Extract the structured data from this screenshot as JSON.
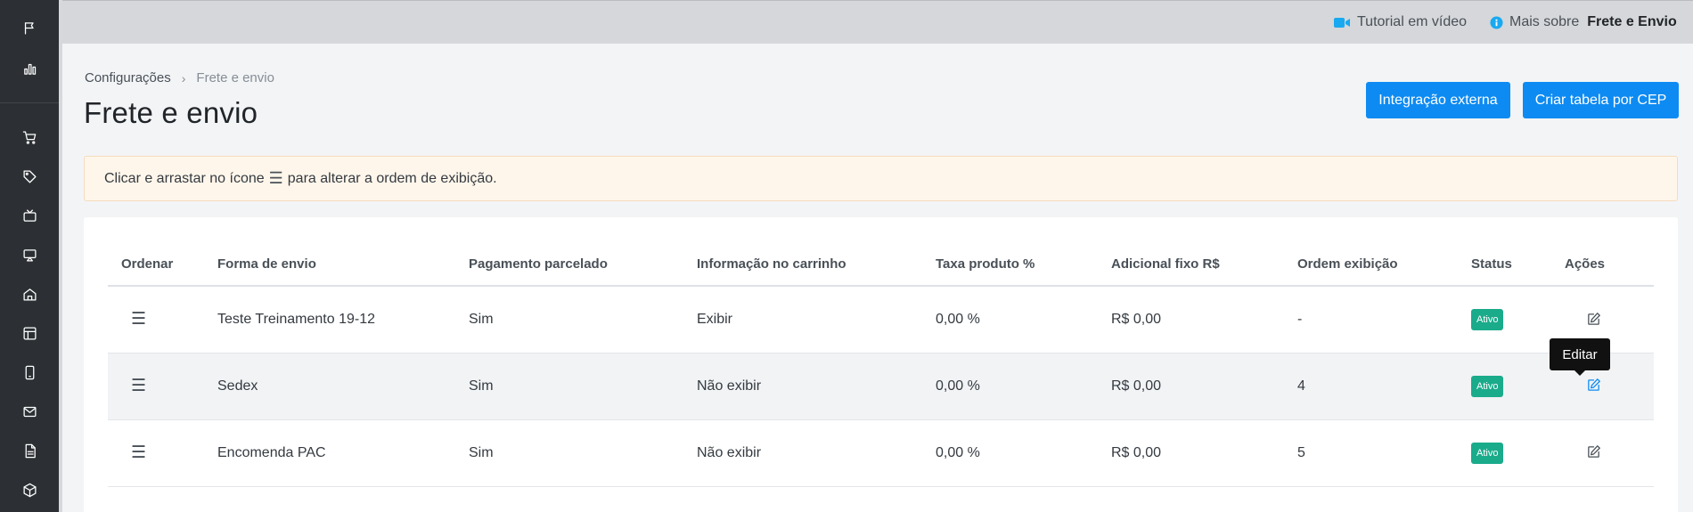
{
  "topbar": {
    "tutorial_label": "Tutorial em vídeo",
    "more_label": "Mais sobre",
    "more_subject": "Frete e Envio"
  },
  "breadcrumb": {
    "parent": "Configurações",
    "current": "Frete e envio"
  },
  "page_title": "Frete e envio",
  "buttons": {
    "integration": "Integração externa",
    "create_table": "Criar tabela por CEP"
  },
  "alert": {
    "before": "Clicar e arrastar no ícone",
    "icon": "☰",
    "after": "para alterar a ordem de exibição."
  },
  "table": {
    "headers": [
      "Ordenar",
      "Forma de envio",
      "Pagamento parcelado",
      "Informação no carrinho",
      "Taxa produto %",
      "Adicional fixo R$",
      "Ordem exibição",
      "Status",
      "Ações"
    ],
    "drag_glyph": "☰",
    "rows": [
      {
        "name": "Teste Treinamento 19-12",
        "installments": "Sim",
        "cart_info": "Exibir",
        "rate": "0,00 %",
        "fixed": "R$ 0,00",
        "order": "-",
        "status": "Ativo"
      },
      {
        "name": "Sedex",
        "installments": "Sim",
        "cart_info": "Não exibir",
        "rate": "0,00 %",
        "fixed": "R$ 0,00",
        "order": "4",
        "status": "Ativo"
      },
      {
        "name": "Encomenda PAC",
        "installments": "Sim",
        "cart_info": "Não exibir",
        "rate": "0,00 %",
        "fixed": "R$ 0,00",
        "order": "5",
        "status": "Ativo"
      }
    ]
  },
  "tooltip": "Editar",
  "colors": {
    "primary": "#0d8bf2",
    "status_active": "#1aab8b",
    "sidebar": "#2c3034",
    "video_icon": "#19a9f0"
  },
  "icons": {
    "sidebar": [
      "flag-icon",
      "bar-chart-icon",
      "cart-icon",
      "tag-icon",
      "tv-icon",
      "monitor-icon",
      "home-icon",
      "layout-icon",
      "smartphone-icon",
      "mail-icon",
      "document-icon",
      "box-icon"
    ]
  }
}
